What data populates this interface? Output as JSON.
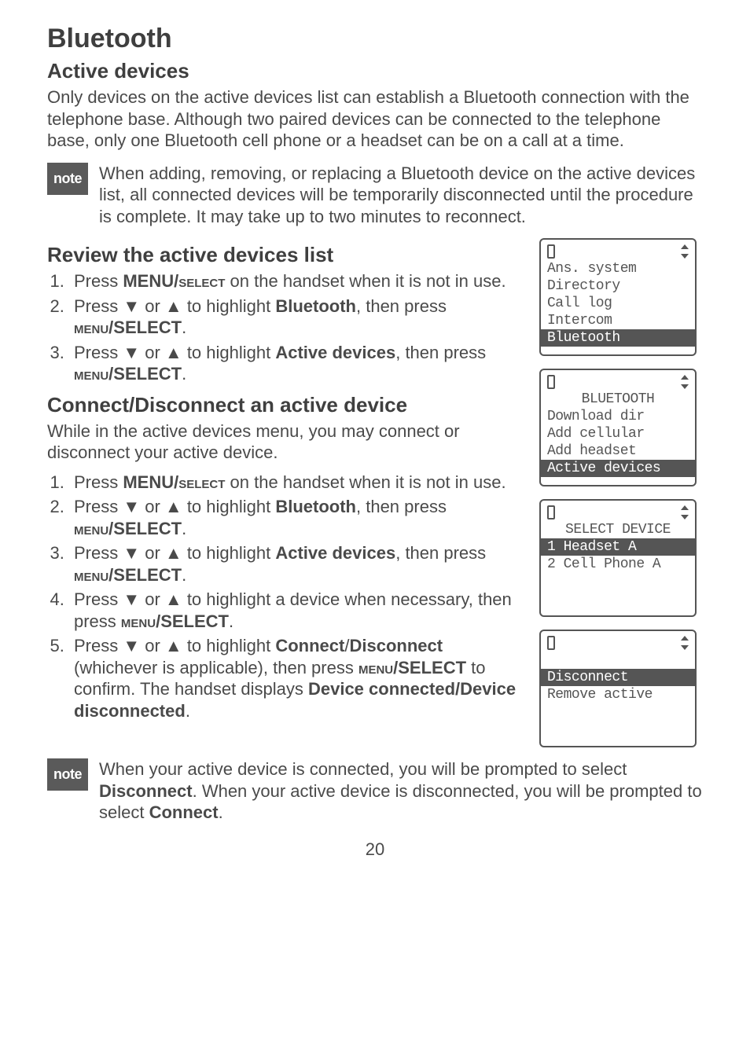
{
  "heading1": "Bluetooth",
  "activeDevices": {
    "heading": "Active devices",
    "para": "Only devices on the active devices list can establish a Bluetooth connection with the telephone base. Although two paired devices can be connected to the telephone base, only one Bluetooth cell phone or a headset can be on a call at a time."
  },
  "noteLabel": "note",
  "note1": "When adding, removing, or replacing a Bluetooth device on the active devices list, all connected devices will be temporarily disconnected until the procedure is complete. It may take up to two minutes to reconnect.",
  "review": {
    "heading": "Review the active devices list",
    "steps": [
      {
        "pre": "Press ",
        "b1": "MENU/",
        "sc": "select",
        "post": " on the handset when it is not in use."
      },
      {
        "pre": "Press ",
        "sym": "▼ or ▲",
        "mid": " to highlight ",
        "b": "Bluetooth",
        "post": ", then press ",
        "sc": "menu",
        "b2": "/SELECT",
        "post2": "."
      },
      {
        "pre": "Press ",
        "sym": "▼ or ▲",
        "mid": " to highlight ",
        "b": "Active devices",
        "post": ", then press ",
        "sc": "menu",
        "b2": "/SELECT",
        "post2": "."
      }
    ]
  },
  "connect": {
    "heading": "Connect/Disconnect an active device",
    "para": "While in the active devices menu, you may connect or disconnect your active device.",
    "steps": [
      {
        "pre": "Press ",
        "b1": "MENU/",
        "sc": "select",
        "post": " on the handset when it is not in use."
      },
      {
        "pre": "Press ",
        "sym": "▼ or ▲",
        "mid": " to highlight ",
        "b": "Bluetooth",
        "post": ", then press ",
        "sc": "menu",
        "b2": "/SELECT",
        "post2": "."
      },
      {
        "pre": "Press ",
        "sym": "▼ or ▲",
        "mid": " to highlight ",
        "b": "Active devices",
        "post": ", then press ",
        "sc": "menu",
        "b2": "/SELECT",
        "post2": "."
      },
      {
        "pre": "Press ",
        "sym": "▼ or ▲",
        "mid": " to highlight a device when necessary, then press ",
        "sc": "menu",
        "b2": "/SELECT",
        "post2": "."
      },
      {
        "pre": "Press ",
        "sym": "▼ or ▲",
        "mid": " to highlight ",
        "b": "Connect",
        "mid2": "/",
        "b3": "Disconnect",
        "post": " (whichever is applicable), then press ",
        "sc": "menu",
        "b2": "/SELECT",
        "mid3": " to confirm. The handset displays ",
        "b4": "Device connected/Device disconnected",
        "post2": "."
      }
    ]
  },
  "note2": {
    "pre": "When your active device is connected, you will be prompted to select ",
    "b": "Disconnect",
    "mid": ". When your active device is disconnected, you will be prompted to select ",
    "b2": "Connect",
    "post": "."
  },
  "screens": {
    "s1": {
      "r1": "Ans. system",
      "r2": "Directory",
      "r3": "Call log",
      "r4": "Intercom",
      "sel": "Bluetooth"
    },
    "s2": {
      "title": "BLUETOOTH",
      "r1": "Download dir",
      "r2": "Add cellular",
      "r3": "Add headset",
      "sel": "Active devices"
    },
    "s3": {
      "title": "SELECT DEVICE",
      "sel": "1 Headset A",
      "r2": "2 Cell Phone A"
    },
    "s4": {
      "sel": "Disconnect",
      "r2": "Remove active"
    }
  },
  "pageNumber": "20"
}
